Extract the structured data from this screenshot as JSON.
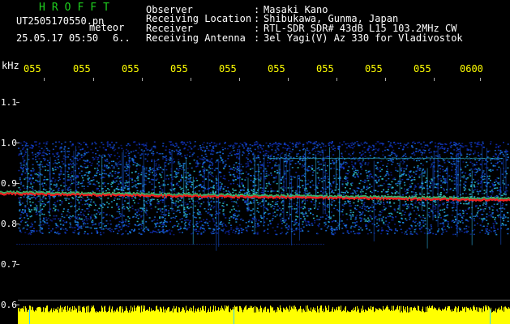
{
  "header": {
    "title": "HROFFT",
    "filename": "UT2505170550.pn",
    "mode": "meteor",
    "datetime": "25.05.17 05:50",
    "count": "6..",
    "fields": [
      {
        "label": "Observer",
        "value": "Masaki Kano"
      },
      {
        "label": "Receiving Location",
        "value": "Shibukawa, Gunma, Japan"
      },
      {
        "label": "Receiver",
        "value": "RTL-SDR SDR# 43dB L15 103.2MHz CW"
      },
      {
        "label": "Receiving Antenna",
        "value": "3el Yagi(V) Az 330 for Vladivostok"
      }
    ],
    "separator": ":"
  },
  "axis": {
    "unit": "kHz",
    "y_labels": [
      "1.1",
      "1.0",
      "0.9",
      "0.8",
      "0.7",
      "0.6"
    ],
    "time_labels": [
      "055",
      "055",
      "055",
      "055",
      "055",
      "055",
      "055",
      "055",
      "055",
      "0600"
    ]
  },
  "colors": {
    "title": "#1fd11f",
    "text": "#ffffff",
    "time": "#ffff00",
    "noise_floor": "#ffff00",
    "carrier": "#ff2020"
  }
}
